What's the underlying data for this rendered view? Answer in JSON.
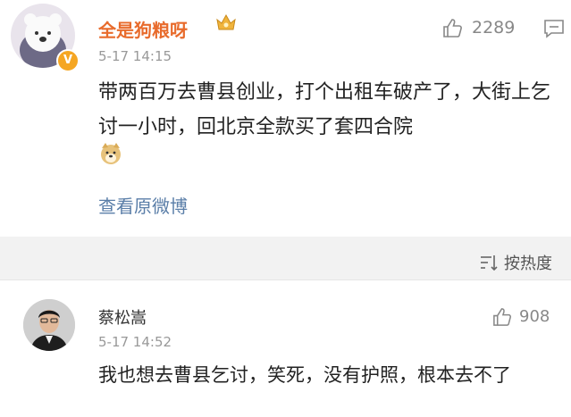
{
  "comment1": {
    "username": "全是狗粮呀",
    "timestamp": "5-17 14:15",
    "like_count": "2289",
    "text": "带两百万去曹县创业，打个出租车破产了，大街上乞讨一小时，回北京全款买了套四合院",
    "view_original_label": "查看原微博",
    "badge": "V",
    "icons": [
      "vip-crown-icon",
      "like-icon",
      "comment-icon",
      "doge-emoji-icon"
    ]
  },
  "sort": {
    "label": "按热度",
    "icon": "sort-icon"
  },
  "comment2": {
    "username": "蔡松嵩",
    "timestamp": "5-17 14:52",
    "like_count": "908",
    "text": "我也想去曹县乞讨，笑死，没有护照，根本去不了",
    "icons": [
      "like-icon"
    ]
  },
  "colors": {
    "username_highlight": "#e86b2c",
    "link": "#5a7ea8",
    "muted": "#999999",
    "badge": "#f5a623"
  }
}
